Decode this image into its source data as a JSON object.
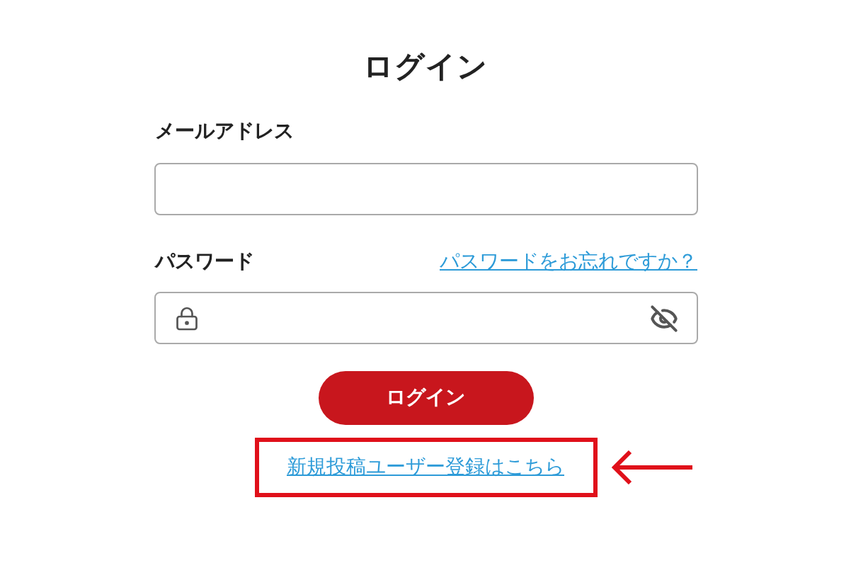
{
  "title": "ログイン",
  "email": {
    "label": "メールアドレス"
  },
  "password": {
    "label": "パスワード",
    "forgot_link": "パスワードをお忘れですか？"
  },
  "login_button": "ログイン",
  "register_link": {
    "text": "新規投稿ユーザー登録はこちら",
    "highlighted": true
  }
}
